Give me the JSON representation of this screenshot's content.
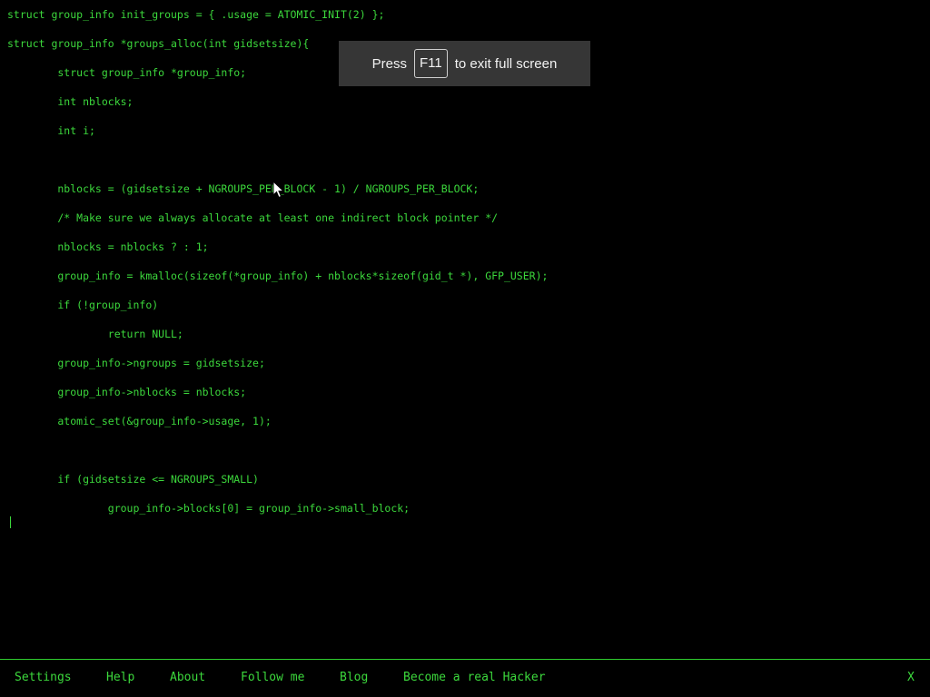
{
  "code": {
    "lines": [
      "struct group_info init_groups = { .usage = ATOMIC_INIT(2) };",
      "struct group_info *groups_alloc(int gidsetsize){",
      "        struct group_info *group_info;",
      "        int nblocks;",
      "        int i;",
      "",
      "        nblocks = (gidsetsize + NGROUPS_PER_BLOCK - 1) / NGROUPS_PER_BLOCK;",
      "        /* Make sure we always allocate at least one indirect block pointer */",
      "        nblocks = nblocks ? : 1;",
      "        group_info = kmalloc(sizeof(*group_info) + nblocks*sizeof(gid_t *), GFP_USER);",
      "        if (!group_info)",
      "                return NULL;",
      "        group_info->ngroups = gidsetsize;",
      "        group_info->nblocks = nblocks;",
      "        atomic_set(&group_info->usage, 1);",
      "",
      "        if (gidsetsize <= NGROUPS_SMALL)",
      "                group_info->blocks[0] = group_info->small_block;"
    ]
  },
  "fullscreen_notice": {
    "prefix": "Press",
    "key": "F11",
    "suffix": "to exit full screen"
  },
  "footer": {
    "links": [
      "Settings",
      "Help",
      "About",
      "Follow me",
      "Blog",
      "Become a real Hacker"
    ],
    "close_label": "X"
  },
  "colors": {
    "background": "#000000",
    "text": "#3cd83c",
    "toast_background": "#3a3a3a"
  }
}
